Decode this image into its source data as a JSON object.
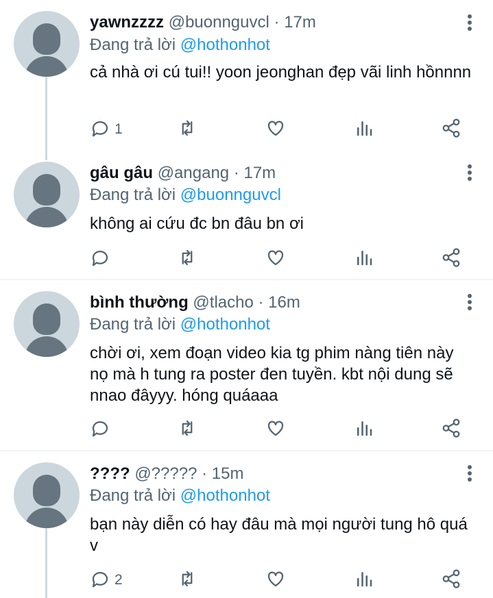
{
  "tweets": [
    {
      "name": "yawnzzzz",
      "handle": "@buonnguvcl",
      "time": "17m",
      "reply_prefix": "Đang trả lời",
      "reply_to": "@hothonhot",
      "text": "cả nhà ơi cú tui!!  yoon jeonghan đẹp vãi linh hồnnnn",
      "reply_count": "1"
    },
    {
      "name": "gâu gâu",
      "handle": "@angang",
      "time": "17m",
      "reply_prefix": "Đang trả lời",
      "reply_to": "@buonnguvcl",
      "text": "không ai cứu đc bn đâu bn ơi",
      "reply_count": ""
    },
    {
      "name": "bình thường",
      "handle": "@tlacho",
      "time": "16m",
      "reply_prefix": "Đang trả lời",
      "reply_to": "@hothonhot",
      "text": "chời ơi, xem đoạn video kia tg phim nàng tiên này nọ mà h tung ra poster đen tuyền. kbt nội dung sẽ nnao đâyyy. hóng quáaaa",
      "reply_count": ""
    },
    {
      "name": "????",
      "handle": "@?????",
      "time": "15m",
      "reply_prefix": "Đang trả lời",
      "reply_to": "@hothonhot",
      "text": "bạn này diễn có hay đâu mà mọi người tung hô quá v",
      "reply_count": "2"
    }
  ],
  "separator": "·",
  "icons": {
    "reply": "reply-icon",
    "retweet": "retweet-icon",
    "like": "heart-icon",
    "views": "analytics-icon",
    "share": "share-icon",
    "more": "more-icon"
  },
  "colors": {
    "mention": "#1d9bf0",
    "secondary": "#536471",
    "avatar_bg": "#ccd6dd",
    "avatar_fg": "#66757f"
  }
}
